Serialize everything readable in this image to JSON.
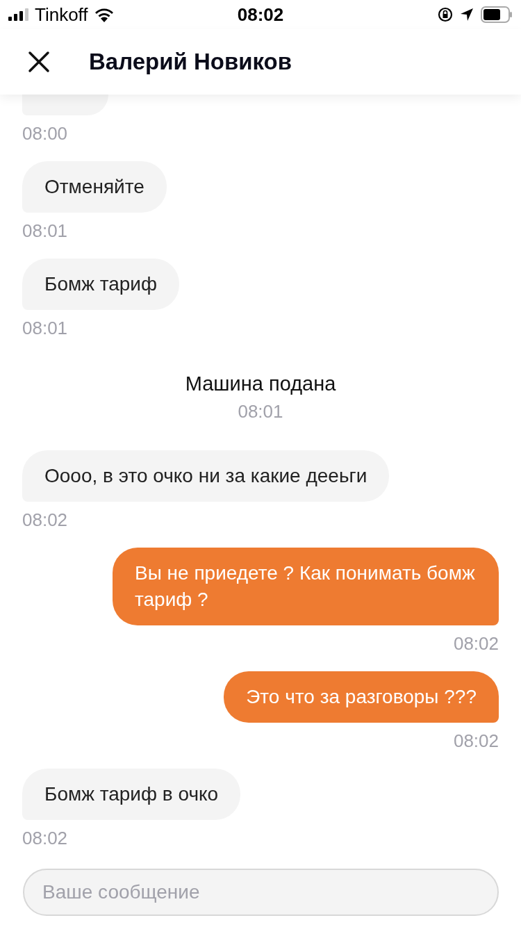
{
  "status_bar": {
    "carrier": "Tinkoff",
    "time": "08:02"
  },
  "header": {
    "title": "Валерий Новиков"
  },
  "messages": [
    {
      "kind": "incoming",
      "time": "08:00"
    },
    {
      "kind": "incoming",
      "text": "Отменяйте",
      "time": "08:01"
    },
    {
      "kind": "incoming",
      "text": "Бомж тариф",
      "time": "08:01"
    },
    {
      "kind": "system",
      "text": "Машина подана",
      "time": "08:01"
    },
    {
      "kind": "incoming",
      "text": "Оооо, в это очко ни за какие дееьги",
      "time": "08:02"
    },
    {
      "kind": "outgoing",
      "text": "Вы не приедете ? Как понимать бомж тариф ?",
      "time": "08:02"
    },
    {
      "kind": "outgoing",
      "text": "Это что за разговоры ???",
      "time": "08:02"
    },
    {
      "kind": "incoming",
      "text": "Бомж тариф в очко",
      "time": "08:02"
    }
  ],
  "composer": {
    "placeholder": "Ваше сообщение"
  }
}
